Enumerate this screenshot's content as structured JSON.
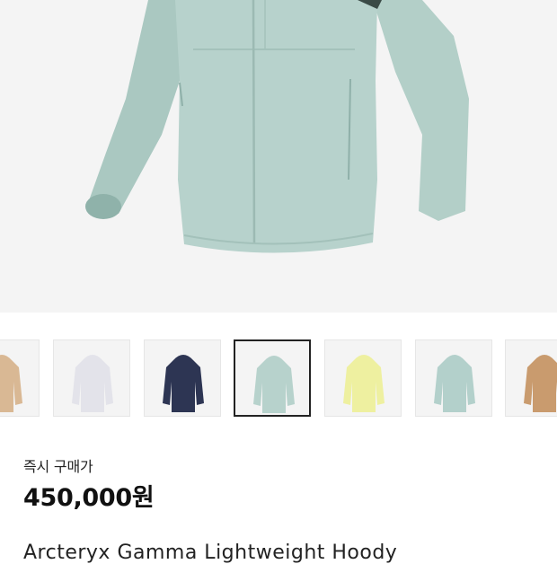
{
  "hero": {
    "product_color": "#b7d2cc"
  },
  "thumbnails": [
    {
      "color": "#d9b894",
      "selected": false
    },
    {
      "color": "#e3e3ea",
      "selected": false
    },
    {
      "color": "#2d3553",
      "selected": false
    },
    {
      "color": "#b7d2cc",
      "selected": true
    },
    {
      "color": "#eef0a0",
      "selected": false
    },
    {
      "color": "#b3d0cb",
      "selected": false
    },
    {
      "color": "#c99b6e",
      "selected": false
    }
  ],
  "price": {
    "label": "즉시 구매가",
    "value": "450,000원"
  },
  "product": {
    "title": "Arcteryx Gamma Lightweight Hoody"
  }
}
